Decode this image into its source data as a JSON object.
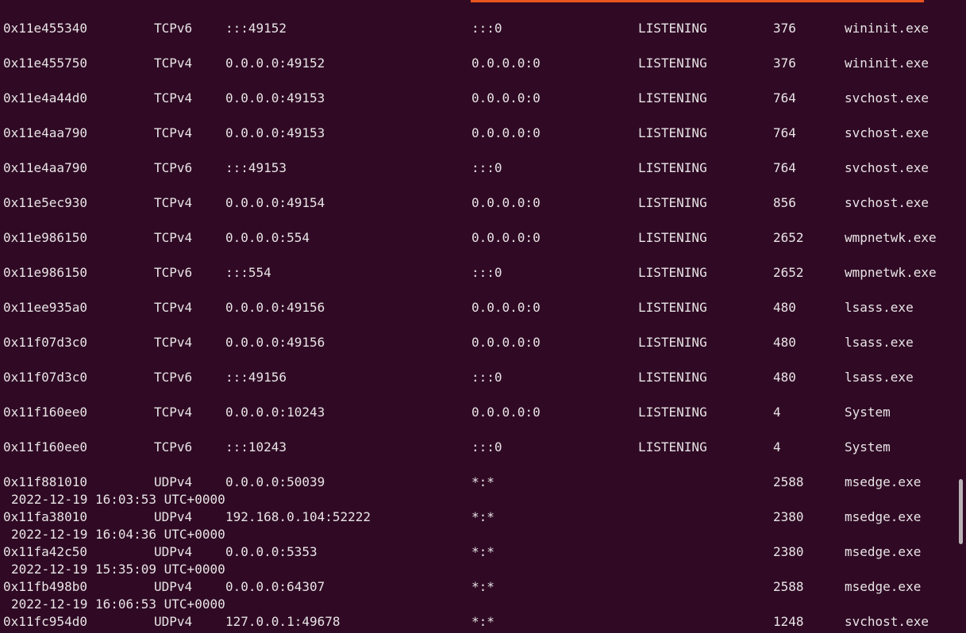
{
  "rows": [
    {
      "offset": "0x11e455340",
      "proto": "TCPv6",
      "local": ":::49152",
      "foreign": ":::0",
      "state": "LISTENING",
      "pid": "376",
      "owner": "wininit.exe"
    },
    {
      "offset": "0x11e455750",
      "proto": "TCPv4",
      "local": "0.0.0.0:49152",
      "foreign": "0.0.0.0:0",
      "state": "LISTENING",
      "pid": "376",
      "owner": "wininit.exe"
    },
    {
      "offset": "0x11e4a44d0",
      "proto": "TCPv4",
      "local": "0.0.0.0:49153",
      "foreign": "0.0.0.0:0",
      "state": "LISTENING",
      "pid": "764",
      "owner": "svchost.exe"
    },
    {
      "offset": "0x11e4aa790",
      "proto": "TCPv4",
      "local": "0.0.0.0:49153",
      "foreign": "0.0.0.0:0",
      "state": "LISTENING",
      "pid": "764",
      "owner": "svchost.exe"
    },
    {
      "offset": "0x11e4aa790",
      "proto": "TCPv6",
      "local": ":::49153",
      "foreign": ":::0",
      "state": "LISTENING",
      "pid": "764",
      "owner": "svchost.exe"
    },
    {
      "offset": "0x11e5ec930",
      "proto": "TCPv4",
      "local": "0.0.0.0:49154",
      "foreign": "0.0.0.0:0",
      "state": "LISTENING",
      "pid": "856",
      "owner": "svchost.exe"
    },
    {
      "offset": "0x11e986150",
      "proto": "TCPv4",
      "local": "0.0.0.0:554",
      "foreign": "0.0.0.0:0",
      "state": "LISTENING",
      "pid": "2652",
      "owner": "wmpnetwk.exe"
    },
    {
      "offset": "0x11e986150",
      "proto": "TCPv6",
      "local": ":::554",
      "foreign": ":::0",
      "state": "LISTENING",
      "pid": "2652",
      "owner": "wmpnetwk.exe"
    },
    {
      "offset": "0x11ee935a0",
      "proto": "TCPv4",
      "local": "0.0.0.0:49156",
      "foreign": "0.0.0.0:0",
      "state": "LISTENING",
      "pid": "480",
      "owner": "lsass.exe"
    },
    {
      "offset": "0x11f07d3c0",
      "proto": "TCPv4",
      "local": "0.0.0.0:49156",
      "foreign": "0.0.0.0:0",
      "state": "LISTENING",
      "pid": "480",
      "owner": "lsass.exe"
    },
    {
      "offset": "0x11f07d3c0",
      "proto": "TCPv6",
      "local": ":::49156",
      "foreign": ":::0",
      "state": "LISTENING",
      "pid": "480",
      "owner": "lsass.exe"
    },
    {
      "offset": "0x11f160ee0",
      "proto": "TCPv4",
      "local": "0.0.0.0:10243",
      "foreign": "0.0.0.0:0",
      "state": "LISTENING",
      "pid": "4",
      "owner": "System"
    },
    {
      "offset": "0x11f160ee0",
      "proto": "TCPv6",
      "local": ":::10243",
      "foreign": ":::0",
      "state": "LISTENING",
      "pid": "4",
      "owner": "System"
    },
    {
      "offset": "0x11f881010",
      "proto": "UDPv4",
      "local": "0.0.0.0:50039",
      "foreign": "*:*",
      "state": "",
      "pid": "2588",
      "owner": "msedge.exe",
      "created": "2022-12-19 16:03:53 UTC+0000"
    },
    {
      "offset": "0x11fa38010",
      "proto": "UDPv4",
      "local": "192.168.0.104:52222",
      "foreign": "*:*",
      "state": "",
      "pid": "2380",
      "owner": "msedge.exe",
      "created": "2022-12-19 16:04:36 UTC+0000"
    },
    {
      "offset": "0x11fa42c50",
      "proto": "UDPv4",
      "local": "0.0.0.0:5353",
      "foreign": "*:*",
      "state": "",
      "pid": "2380",
      "owner": "msedge.exe",
      "created": "2022-12-19 15:35:09 UTC+0000"
    },
    {
      "offset": "0x11fb498b0",
      "proto": "UDPv4",
      "local": "0.0.0.0:64307",
      "foreign": "*:*",
      "state": "",
      "pid": "2588",
      "owner": "msedge.exe",
      "created": "2022-12-19 16:06:53 UTC+0000"
    },
    {
      "offset": "0x11fc954d0",
      "proto": "UDPv4",
      "local": "127.0.0.1:49678",
      "foreign": "*:*",
      "state": "",
      "pid": "1248",
      "owner": "svchost.exe"
    }
  ],
  "colors": {
    "background": "#300a24",
    "text": "#e8e4e6",
    "accent": "#e9541f",
    "scrollbar_thumb": "#b9b1b6"
  }
}
